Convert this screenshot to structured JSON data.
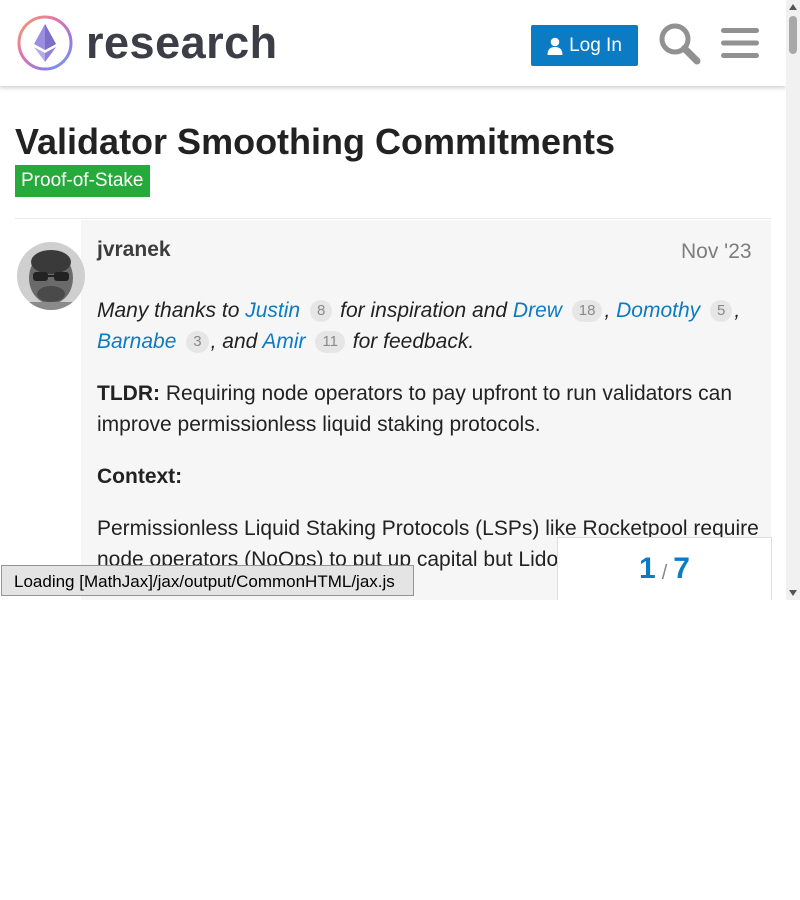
{
  "header": {
    "site_name": "research",
    "login_label": "Log In",
    "icons": [
      "ethereum-logo-icon",
      "user-icon",
      "search-icon",
      "hamburger-menu-icon"
    ]
  },
  "topic": {
    "title": "Validator Smoothing Commitments",
    "category": "Proof-of-Stake"
  },
  "post": {
    "username": "jvranek",
    "date": "Nov '23",
    "thanks": {
      "prefix": "Many thanks to ",
      "mentions": [
        {
          "name": "Justin",
          "count": "8"
        },
        {
          "name": "Drew",
          "count": "18"
        },
        {
          "name": "Domothy",
          "count": "5"
        },
        {
          "name": "Barnabe",
          "count": "3"
        },
        {
          "name": "Amir",
          "count": "11"
        }
      ],
      "mid": " for inspiration and ",
      "sep1": ", ",
      "sep2": ",",
      "sep3": ", and ",
      "suffix": " for feedback."
    },
    "tldr_label": "TLDR:",
    "tldr_text": " Requiring node operators to pay upfront to run validators can improve permissionless liquid staking protocols.",
    "context_label": "Context:",
    "context_text": "Permissionless Liquid Staking Protocols (LSPs) like Rocketpool require node operators (NoOps) to put up capital but Lido do not and"
  },
  "timeline": {
    "current": "1",
    "separator": "/",
    "total": "7"
  },
  "mathjax_status": "Loading [MathJax]/jax/output/CommonHTML/jax.js",
  "colors": {
    "accent": "#0b7bc4",
    "category": "#25aa3b",
    "title": "#222222",
    "post_bg": "#f6f6f6"
  }
}
